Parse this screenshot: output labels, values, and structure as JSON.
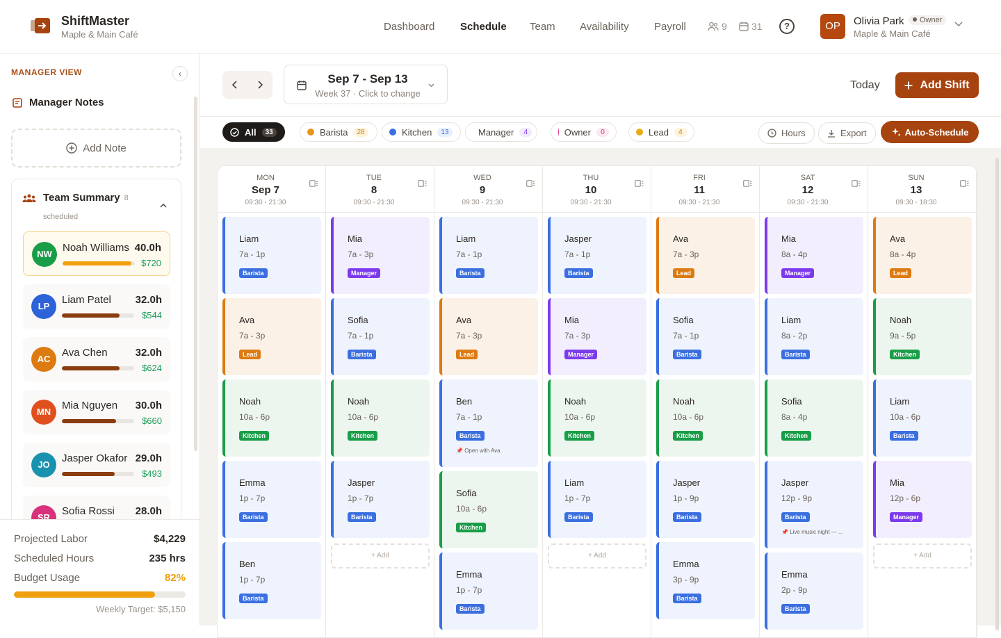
{
  "brand": {
    "name": "ShiftMaster",
    "location": "Maple & Main Café"
  },
  "nav": {
    "items": [
      "Dashboard",
      "Schedule",
      "Team",
      "Availability",
      "Payroll"
    ],
    "active": "Schedule",
    "team_count": "9",
    "calendar_count": "31"
  },
  "user": {
    "initials": "OP",
    "name": "Olivia Park",
    "role": "Owner",
    "location": "Maple & Main Café"
  },
  "sidebar": {
    "view_label": "MANAGER VIEW",
    "notes_title": "Manager Notes",
    "add_note": "Add Note",
    "team_summary": {
      "title": "Team Summary",
      "count": "8",
      "sub": "scheduled",
      "members": [
        {
          "initials": "NW",
          "name": "Noah Williams",
          "hours": "40.0h",
          "pay": "$720",
          "color": "#1a9d48",
          "fill": 0.95,
          "fill_color": "#f0a00e",
          "highlight": true
        },
        {
          "initials": "LP",
          "name": "Liam Patel",
          "hours": "32.0h",
          "pay": "$544",
          "color": "#2d63d8",
          "fill": 0.8,
          "fill_color": "#8a3d10"
        },
        {
          "initials": "AC",
          "name": "Ava Chen",
          "hours": "32.0h",
          "pay": "$624",
          "color": "#dd7a12",
          "fill": 0.8,
          "fill_color": "#8a3d10"
        },
        {
          "initials": "MN",
          "name": "Mia Nguyen",
          "hours": "30.0h",
          "pay": "$660",
          "color": "#e0501f",
          "fill": 0.75,
          "fill_color": "#8a3d10"
        },
        {
          "initials": "JO",
          "name": "Jasper Okafor",
          "hours": "29.0h",
          "pay": "$493",
          "color": "#1992b0",
          "fill": 0.73,
          "fill_color": "#8a3d10"
        },
        {
          "initials": "SR",
          "name": "Sofia Rossi",
          "hours": "28.0h",
          "pay": "",
          "color": "#d8327a",
          "fill": 0.7,
          "fill_color": "#8a3d10"
        }
      ]
    },
    "summary": {
      "projected_label": "Projected Labor",
      "projected": "$4,229",
      "hours_label": "Scheduled Hours",
      "hours": "235 hrs",
      "budget_label": "Budget Usage",
      "budget": "82%",
      "budget_fraction": 0.82,
      "target": "Weekly Target: $5,150"
    }
  },
  "toolbar": {
    "week_title": "Sep 7 - Sep 13",
    "week_sub": "Week 37 · Click to change",
    "today": "Today",
    "add_shift": "Add Shift"
  },
  "filters": [
    {
      "label": "All",
      "count": "33",
      "type": "all"
    },
    {
      "label": "Barista",
      "count": "28",
      "dot": "#e8941a",
      "cnt_bg": "#fdf3dd",
      "cnt_color": "#c98512"
    },
    {
      "label": "Kitchen",
      "count": "13",
      "dot": "#3b6fe0",
      "cnt_bg": "#e8f0fd",
      "cnt_color": "#3b6fe0"
    },
    {
      "label": "Manager",
      "count": "4",
      "dot": "#8b4ce8",
      "cnt_bg": "#f1eafd",
      "cnt_color": "#7c3aed"
    },
    {
      "label": "Owner",
      "count": "0",
      "dot": "#e0418a",
      "cnt_bg": "#fde8f1",
      "cnt_color": "#d8327a"
    },
    {
      "label": "Lead",
      "count": "4",
      "dot": "#e8ac12",
      "cnt_bg": "#fdf3dd",
      "cnt_color": "#c98512"
    }
  ],
  "tools": {
    "hours": "Hours",
    "export": "Export",
    "auto": "Auto-Schedule"
  },
  "add_label": "Add",
  "days": [
    {
      "dow": "MON",
      "date": "Sep 7",
      "hours": "09:30 - 21:30",
      "shifts": [
        {
          "name": "Liam",
          "time": "7a - 1p",
          "role": "Barista"
        },
        {
          "name": "Ava",
          "time": "7a - 3p",
          "role": "Lead"
        },
        {
          "name": "Noah",
          "time": "10a - 6p",
          "role": "Kitchen"
        },
        {
          "name": "Emma",
          "time": "1p - 7p",
          "role": "Barista"
        },
        {
          "name": "Ben",
          "time": "1p - 7p",
          "role": "Barista"
        }
      ]
    },
    {
      "dow": "TUE",
      "date": "8",
      "hours": "09:30 - 21:30",
      "shifts": [
        {
          "name": "Mia",
          "time": "7a - 3p",
          "role": "Manager"
        },
        {
          "name": "Sofia",
          "time": "7a - 1p",
          "role": "Barista"
        },
        {
          "name": "Noah",
          "time": "10a - 6p",
          "role": "Kitchen"
        },
        {
          "name": "Jasper",
          "time": "1p - 7p",
          "role": "Barista"
        }
      ],
      "add": true
    },
    {
      "dow": "WED",
      "date": "9",
      "hours": "09:30 - 21:30",
      "shifts": [
        {
          "name": "Liam",
          "time": "7a - 1p",
          "role": "Barista"
        },
        {
          "name": "Ava",
          "time": "7a - 3p",
          "role": "Lead"
        },
        {
          "name": "Ben",
          "time": "7a - 1p",
          "role": "Barista",
          "note": "Open with Ava"
        },
        {
          "name": "Sofia",
          "time": "10a - 6p",
          "role": "Kitchen"
        },
        {
          "name": "Emma",
          "time": "1p - 7p",
          "role": "Barista"
        }
      ]
    },
    {
      "dow": "THU",
      "date": "10",
      "hours": "09:30 - 21:30",
      "shifts": [
        {
          "name": "Jasper",
          "time": "7a - 1p",
          "role": "Barista"
        },
        {
          "name": "Mia",
          "time": "7a - 3p",
          "role": "Manager"
        },
        {
          "name": "Noah",
          "time": "10a - 6p",
          "role": "Kitchen"
        },
        {
          "name": "Liam",
          "time": "1p - 7p",
          "role": "Barista"
        }
      ],
      "add": true
    },
    {
      "dow": "FRI",
      "date": "11",
      "hours": "09:30 - 21:30",
      "shifts": [
        {
          "name": "Ava",
          "time": "7a - 3p",
          "role": "Lead"
        },
        {
          "name": "Sofia",
          "time": "7a - 1p",
          "role": "Barista"
        },
        {
          "name": "Noah",
          "time": "10a - 6p",
          "role": "Kitchen"
        },
        {
          "name": "Jasper",
          "time": "1p - 9p",
          "role": "Barista"
        },
        {
          "name": "Emma",
          "time": "3p - 9p",
          "role": "Barista"
        }
      ]
    },
    {
      "dow": "SAT",
      "date": "12",
      "hours": "09:30 - 21:30",
      "shifts": [
        {
          "name": "Mia",
          "time": "8a - 4p",
          "role": "Manager"
        },
        {
          "name": "Liam",
          "time": "8a - 2p",
          "role": "Barista"
        },
        {
          "name": "Sofia",
          "time": "8a - 4p",
          "role": "Kitchen"
        },
        {
          "name": "Jasper",
          "time": "12p - 9p",
          "role": "Barista",
          "note": "Live music night — ..."
        },
        {
          "name": "Emma",
          "time": "2p - 9p",
          "role": "Barista"
        }
      ]
    },
    {
      "dow": "SUN",
      "date": "13",
      "hours": "09:30 - 18:30",
      "shifts": [
        {
          "name": "Ava",
          "time": "8a - 4p",
          "role": "Lead"
        },
        {
          "name": "Noah",
          "time": "9a - 5p",
          "role": "Kitchen"
        },
        {
          "name": "Liam",
          "time": "10a - 6p",
          "role": "Barista"
        },
        {
          "name": "Mia",
          "time": "12p - 6p",
          "role": "Manager"
        }
      ],
      "add": true
    }
  ]
}
